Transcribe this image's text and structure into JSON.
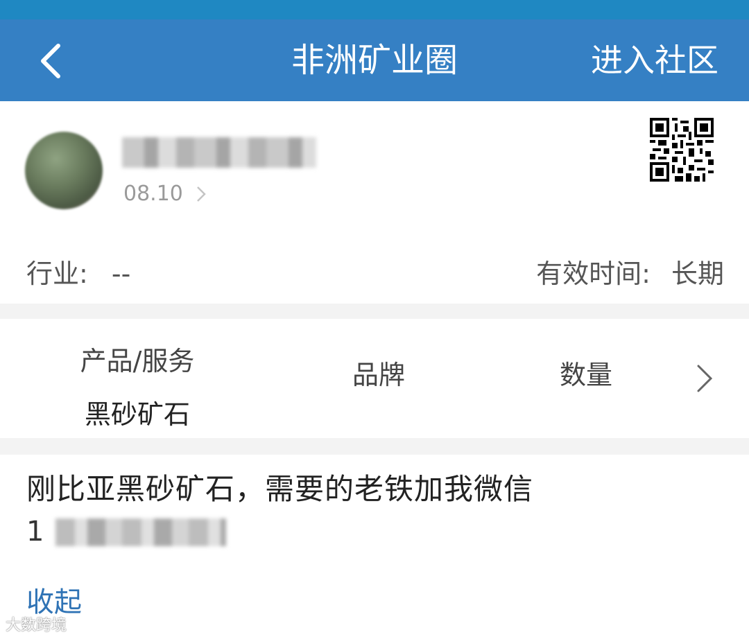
{
  "header": {
    "title": "非洲矿业圈",
    "action_label": "进入社区"
  },
  "profile": {
    "date": "08.10"
  },
  "info": {
    "industry_label": "行业:",
    "industry_value": "--",
    "validity_label": "有效时间:",
    "validity_value": "长期"
  },
  "product": {
    "columns": [
      {
        "label": "产品/服务",
        "value": "黑砂矿石"
      },
      {
        "label": "品牌",
        "value": ""
      },
      {
        "label": "数量",
        "value": ""
      }
    ]
  },
  "description": {
    "text": "刚比亚黑砂矿石，需要的老铁加我微信",
    "phone_prefix": "1"
  },
  "collapse_label": "收起",
  "watermark": "大数跨境",
  "colors": {
    "header_bg": "#3580c4",
    "status_bar_bg": "#1f88c2",
    "link": "#2f73b5",
    "separator": "#f3f3f3"
  },
  "icons": [
    "chevron-left-icon",
    "chevron-right-icon",
    "qr-code-icon"
  ]
}
